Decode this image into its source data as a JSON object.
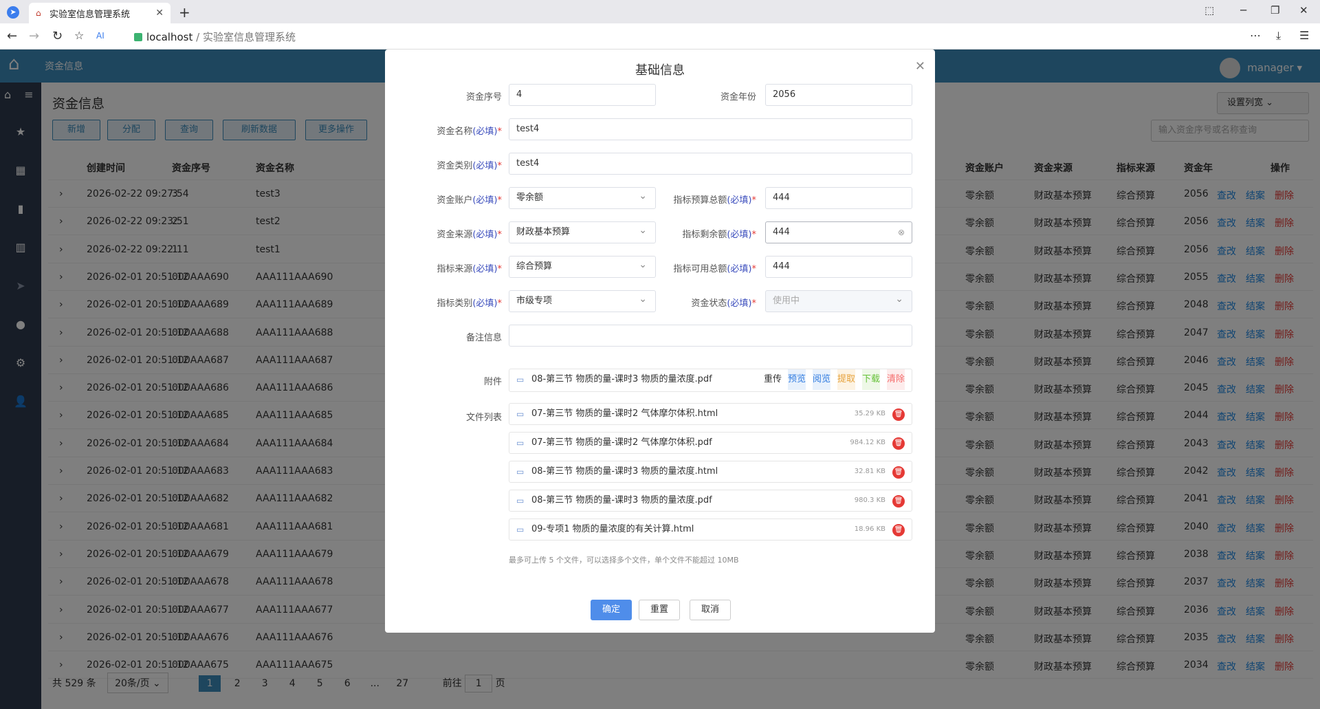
{
  "browser": {
    "tab_title": "实验室信息管理系统",
    "url_host": "localhost",
    "url_path": "/ 实验室信息管理系统"
  },
  "app": {
    "section": "资金信息",
    "user": "manager",
    "page_title": "资金信息",
    "buttons": [
      "新增",
      "分配",
      "查询",
      "刷新数据",
      "更多操作"
    ],
    "set_columns": "设置列宽",
    "search_placeholder": "输入资金序号或名称查询",
    "columns": [
      "创建时间",
      "资金序号",
      "资金名称",
      "资金账户",
      "资金来源",
      "指标来源",
      "资金年",
      "操作"
    ],
    "rows": [
      {
        "time": "2026-02-22 09:27:54",
        "seq": "3",
        "name": "test3",
        "acct": "零余额",
        "src": "财政基本预算",
        "isrc": "综合预算",
        "year": "2056"
      },
      {
        "time": "2026-02-22 09:23:51",
        "seq": "2",
        "name": "test2",
        "acct": "零余额",
        "src": "财政基本预算",
        "isrc": "综合预算",
        "year": "2056"
      },
      {
        "time": "2026-02-22 09:22:11",
        "seq": "1",
        "name": "test1",
        "acct": "零余额",
        "src": "财政基本预算",
        "isrc": "综合预算",
        "year": "2056"
      },
      {
        "time": "2026-02-01 20:51:12",
        "seq": "000AAA690",
        "name": "AAA111AAA690",
        "acct": "零余额",
        "src": "财政基本预算",
        "isrc": "综合预算",
        "year": "2055"
      },
      {
        "time": "2026-02-01 20:51:12",
        "seq": "000AAA689",
        "name": "AAA111AAA689",
        "acct": "零余额",
        "src": "财政基本预算",
        "isrc": "综合预算",
        "year": "2048"
      },
      {
        "time": "2026-02-01 20:51:12",
        "seq": "000AAA688",
        "name": "AAA111AAA688",
        "acct": "零余额",
        "src": "财政基本预算",
        "isrc": "综合预算",
        "year": "2047"
      },
      {
        "time": "2026-02-01 20:51:12",
        "seq": "000AAA687",
        "name": "AAA111AAA687",
        "acct": "零余额",
        "src": "财政基本预算",
        "isrc": "综合预算",
        "year": "2046"
      },
      {
        "time": "2026-02-01 20:51:12",
        "seq": "000AAA686",
        "name": "AAA111AAA686",
        "acct": "零余额",
        "src": "财政基本预算",
        "isrc": "综合预算",
        "year": "2045"
      },
      {
        "time": "2026-02-01 20:51:12",
        "seq": "000AAA685",
        "name": "AAA111AAA685",
        "acct": "零余额",
        "src": "财政基本预算",
        "isrc": "综合预算",
        "year": "2044"
      },
      {
        "time": "2026-02-01 20:51:12",
        "seq": "000AAA684",
        "name": "AAA111AAA684",
        "acct": "零余额",
        "src": "财政基本预算",
        "isrc": "综合预算",
        "year": "2043"
      },
      {
        "time": "2026-02-01 20:51:12",
        "seq": "000AAA683",
        "name": "AAA111AAA683",
        "acct": "零余额",
        "src": "财政基本预算",
        "isrc": "综合预算",
        "year": "2042"
      },
      {
        "time": "2026-02-01 20:51:12",
        "seq": "000AAA682",
        "name": "AAA111AAA682",
        "acct": "零余额",
        "src": "财政基本预算",
        "isrc": "综合预算",
        "year": "2041"
      },
      {
        "time": "2026-02-01 20:51:12",
        "seq": "000AAA681",
        "name": "AAA111AAA681",
        "acct": "零余额",
        "src": "财政基本预算",
        "isrc": "综合预算",
        "year": "2040"
      },
      {
        "time": "2026-02-01 20:51:12",
        "seq": "000AAA679",
        "name": "AAA111AAA679",
        "acct": "零余额",
        "src": "财政基本预算",
        "isrc": "综合预算",
        "year": "2038"
      },
      {
        "time": "2026-02-01 20:51:12",
        "seq": "000AAA678",
        "name": "AAA111AAA678",
        "acct": "零余额",
        "src": "财政基本预算",
        "isrc": "综合预算",
        "year": "2037"
      },
      {
        "time": "2026-02-01 20:51:12",
        "seq": "000AAA677",
        "name": "AAA111AAA677",
        "acct": "零余额",
        "src": "财政基本预算",
        "isrc": "综合预算",
        "year": "2036"
      },
      {
        "time": "2026-02-01 20:51:12",
        "seq": "000AAA676",
        "name": "AAA111AAA676",
        "acct": "零余额",
        "src": "财政基本预算",
        "isrc": "综合预算",
        "year": "2035"
      },
      {
        "time": "2026-02-01 20:51:12",
        "seq": "000AAA675",
        "name": "AAA111AAA675",
        "acct": "零余额",
        "src": "财政基本预算",
        "isrc": "综合预算",
        "year": "2034"
      }
    ],
    "row_ops": [
      "查改",
      "结案",
      "删除"
    ],
    "pager": {
      "total": "共 529 条",
      "per_page": "20条/页",
      "pages": [
        "1",
        "2",
        "3",
        "4",
        "5",
        "6",
        "...",
        "27"
      ],
      "goto": "前往",
      "goto_value": "1",
      "page_unit": "页"
    }
  },
  "dialog": {
    "title": "基础信息",
    "req": "(必填)",
    "fields": {
      "seq_label": "资金序号",
      "seq_value": "4",
      "year_label": "资金年份",
      "year_value": "2056",
      "name_label": "资金名称",
      "name_value": "test4",
      "type_label": "资金类别",
      "type_value": "test4",
      "acct_label": "资金账户",
      "acct_value": "零余额",
      "budget_label": "指标预算总额",
      "budget_value": "444",
      "src_label": "资金来源",
      "src_value": "财政基本预算",
      "remain_label": "指标剩余额",
      "remain_value": "444",
      "isrc_label": "指标来源",
      "isrc_value": "综合预算",
      "avail_label": "指标可用总额",
      "avail_value": "444",
      "itype_label": "指标类别",
      "itype_value": "市级专项",
      "status_label": "资金状态",
      "status_value": "使用中",
      "remark_label": "备注信息",
      "remark_value": "",
      "attach_label": "附件",
      "attach_value": "08-第三节 物质的量-课时3 物质的量浓度.pdf",
      "files_label": "文件列表"
    },
    "attach_actions": [
      "重传",
      "预览",
      "阅览",
      "提取",
      "下载",
      "清除"
    ],
    "files": [
      {
        "name": "07-第三节 物质的量-课时2 气体摩尔体积.html",
        "size": "35.29 KB"
      },
      {
        "name": "07-第三节 物质的量-课时2 气体摩尔体积.pdf",
        "size": "984.12 KB"
      },
      {
        "name": "08-第三节 物质的量-课时3 物质的量浓度.html",
        "size": "32.81 KB"
      },
      {
        "name": "08-第三节 物质的量-课时3 物质的量浓度.pdf",
        "size": "980.3 KB"
      },
      {
        "name": "09-专项1 物质的量浓度的有关计算.html",
        "size": "18.96 KB"
      }
    ],
    "hint": "最多可上传 5 个文件，可以选择多个文件，单个文件不能超过 10MB",
    "buttons": {
      "ok": "确定",
      "reset": "重置",
      "cancel": "取消"
    },
    "colors": {
      "primary": "#4f8dea",
      "required": "#3c4ebd",
      "star": "#e53935",
      "action_blue": "#2f7be0",
      "action_orange": "#e6a23c",
      "action_green": "#67c23a",
      "action_red": "#f56c6c"
    }
  }
}
